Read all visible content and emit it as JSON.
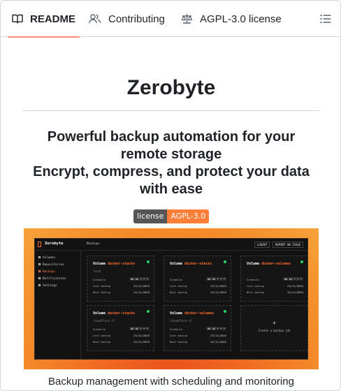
{
  "tabs": [
    {
      "label": "README",
      "icon": "book-icon",
      "active": true
    },
    {
      "label": "Contributing",
      "icon": "people-icon",
      "active": false
    },
    {
      "label": "AGPL-3.0 license",
      "icon": "law-scale-icon",
      "active": false
    }
  ],
  "toc_icon": "list-unordered-icon",
  "readme": {
    "title": "Zerobyte",
    "tagline_lines": [
      "Powerful backup automation for your",
      "remote storage",
      "Encrypt, compress, and protect your data",
      "with ease"
    ],
    "badge": {
      "label": "license",
      "value": "AGPL-3.0",
      "color": "#fe7d37"
    },
    "caption": "Backup management with scheduling and monitoring"
  },
  "app_screenshot": {
    "brand": "Zerobyte",
    "breadcrumb": "Backups",
    "top_buttons": [
      "LOGOUT",
      "REPORT AN ISSUE"
    ],
    "nav": [
      "Volumes",
      "Repositories",
      "Backups",
      "Notifications",
      "Settings"
    ],
    "active_nav": "Backups",
    "cards": [
      {
        "prefix": "Volume",
        "name": "docker-stacks",
        "sub": "local",
        "schedule_label": "Schedule",
        "schedule": "00 02 * * *",
        "last_label": "Last backup",
        "last": "23/11/2025",
        "next_label": "Next backup",
        "next": "24/11/2025"
      },
      {
        "prefix": "Volume",
        "name": "docker-stacks",
        "sub": "",
        "schedule_label": "Schedule",
        "schedule": "00 02 * * *",
        "last_label": "Last backup",
        "last": "23/11/2025",
        "next_label": "Next backup",
        "next": "24/11/2025"
      },
      {
        "prefix": "Volume",
        "name": "docker-volumes",
        "sub": "",
        "schedule_label": "Schedule",
        "schedule": "00 03 * * *",
        "last_label": "Last backup",
        "last": "23/11/2025",
        "next_label": "Next backup",
        "next": "24/11/2025"
      },
      {
        "prefix": "Volume",
        "name": "docker-stacks",
        "sub": "cloudflare-r2",
        "schedule_label": "Schedule",
        "schedule": "00 02 * * *",
        "last_label": "Last backup",
        "last": "23/11/2025",
        "next_label": "Next backup",
        "next": "24/11/2025"
      },
      {
        "prefix": "Volume",
        "name": "docker-volumes",
        "sub": "cloudflare-r2",
        "schedule_label": "Schedule",
        "schedule": "00 03 * * *",
        "last_label": "Last backup",
        "last": "23/11/2025",
        "next_label": "Next backup",
        "next": "24/11/2025"
      }
    ],
    "new_card": {
      "plus": "+",
      "label": "Create a backup job"
    }
  }
}
